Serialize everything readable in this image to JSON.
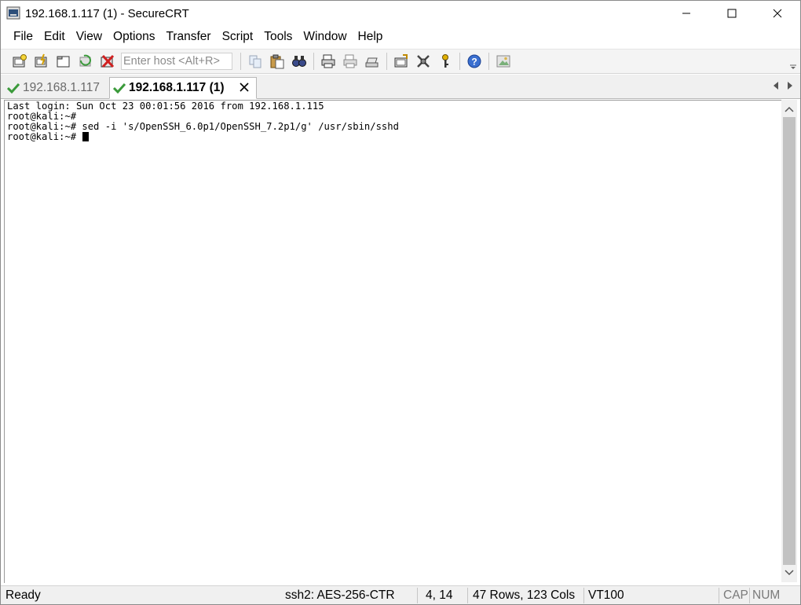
{
  "window": {
    "title": "192.168.1.117 (1) - SecureCRT",
    "app_icon": "securecrt-app-icon",
    "controls": [
      "minimize-icon",
      "maximize-icon",
      "close-icon"
    ]
  },
  "menu": [
    "File",
    "Edit",
    "View",
    "Options",
    "Transfer",
    "Script",
    "Tools",
    "Window",
    "Help"
  ],
  "toolbar": {
    "host_placeholder": "Enter host <Alt+R>",
    "icons": [
      "connect-icon",
      "quick-connect-icon",
      "connect-in-tab-icon",
      "reconnect-icon",
      "disconnect-icon",
      "copy-icon",
      "paste-icon",
      "find-icon",
      "print-icon",
      "print-selection-icon",
      "print-setup-icon",
      "session-options-icon",
      "global-options-icon",
      "keymap-icon",
      "help-icon",
      "image-icon"
    ]
  },
  "tabs": [
    {
      "label": "192.168.1.117",
      "active": false
    },
    {
      "label": "192.168.1.117 (1)",
      "active": true
    }
  ],
  "terminal": {
    "lines": [
      "Last login: Sun Oct 23 00:01:56 2016 from 192.168.1.115",
      "root@kali:~#",
      "root@kali:~# sed -i 's/OpenSSH_6.0p1/OpenSSH_7.2p1/g' /usr/sbin/sshd",
      "root@kali:~# "
    ]
  },
  "status": {
    "ready": "Ready",
    "cipher": "ssh2: AES-256-CTR",
    "position": "4,  14",
    "size": "47 Rows, 123 Cols",
    "emulation": "VT100",
    "caps": "CAP",
    "num": "NUM"
  },
  "colors": {
    "toolbar_bg": "#f4f4f4",
    "tab_check": "#3a9a3a",
    "scroll_thumb": "#c2c2c2"
  }
}
